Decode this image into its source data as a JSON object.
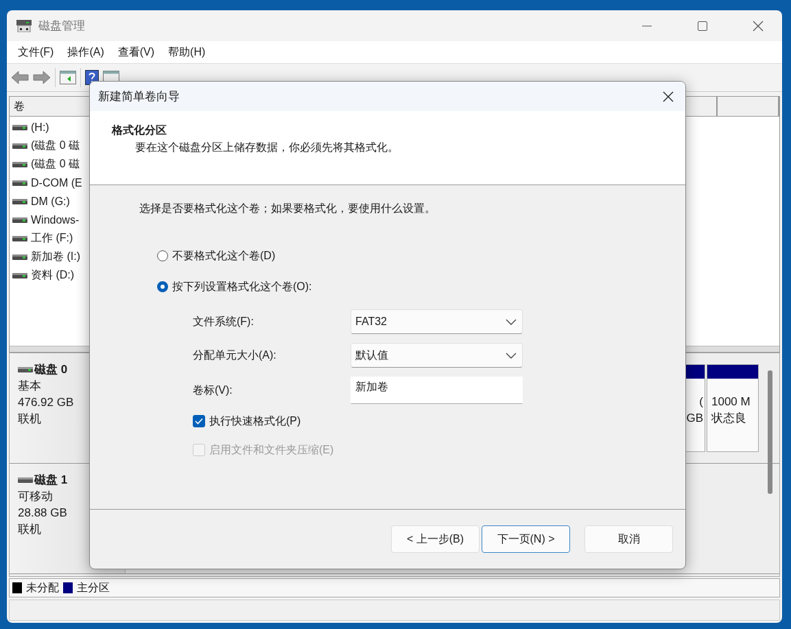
{
  "window": {
    "title": "磁盘管理"
  },
  "menu": [
    {
      "label": "文件(F)"
    },
    {
      "label": "操作(A)"
    },
    {
      "label": "查看(V)"
    },
    {
      "label": "帮助(H)"
    }
  ],
  "volume_list": {
    "columns": [
      "卷"
    ],
    "rows": [
      {
        "name": " (H:)"
      },
      {
        "name": "(磁盘 0 磁"
      },
      {
        "name": "(磁盘 0 磁"
      },
      {
        "name": "D-COM (E"
      },
      {
        "name": "DM (G:)"
      },
      {
        "name": "Windows-"
      },
      {
        "name": "工作 (F:)"
      },
      {
        "name": "新加卷 (I:)"
      },
      {
        "name": "资料 (D:)"
      }
    ]
  },
  "disks": [
    {
      "name": "磁盘 0",
      "type": "基本",
      "size": "476.92 GB",
      "status": "联机",
      "partitions": [
        {
          "lines": [
            "(",
            "GB"
          ]
        },
        {
          "lines": [
            "1000 M",
            "状态良"
          ]
        }
      ]
    },
    {
      "name": "磁盘 1",
      "type": "可移动",
      "size": "28.88 GB",
      "status": "联机"
    }
  ],
  "legend": [
    {
      "label": "未分配",
      "color": "#000000"
    },
    {
      "label": "主分区",
      "color": "#000080"
    }
  ],
  "dialog": {
    "title": "新建简单卷向导",
    "heading": "格式化分区",
    "subheading": "要在这个磁盘分区上储存数据，你必须先将其格式化。",
    "prompt": "选择是否要格式化这个卷；如果要格式化，要使用什么设置。",
    "options": [
      {
        "label": "不要格式化这个卷(D)",
        "selected": false
      },
      {
        "label": "按下列设置格式化这个卷(O):",
        "selected": true
      }
    ],
    "fields": [
      {
        "label": "文件系统(F):",
        "kind": "dropdown",
        "value": "FAT32"
      },
      {
        "label": "分配单元大小(A):",
        "kind": "dropdown",
        "value": "默认值"
      },
      {
        "label": "卷标(V):",
        "kind": "text",
        "value": "新加卷"
      }
    ],
    "checkboxes": [
      {
        "label": "执行快速格式化(P)",
        "checked": true,
        "disabled": false
      },
      {
        "label": "启用文件和文件夹压缩(E)",
        "checked": false,
        "disabled": true
      }
    ],
    "buttons": [
      {
        "label": "< 上一步(B)",
        "focused": false
      },
      {
        "label": "下一页(N) >",
        "focused": true
      },
      {
        "label": "取消",
        "focused": false
      }
    ]
  }
}
